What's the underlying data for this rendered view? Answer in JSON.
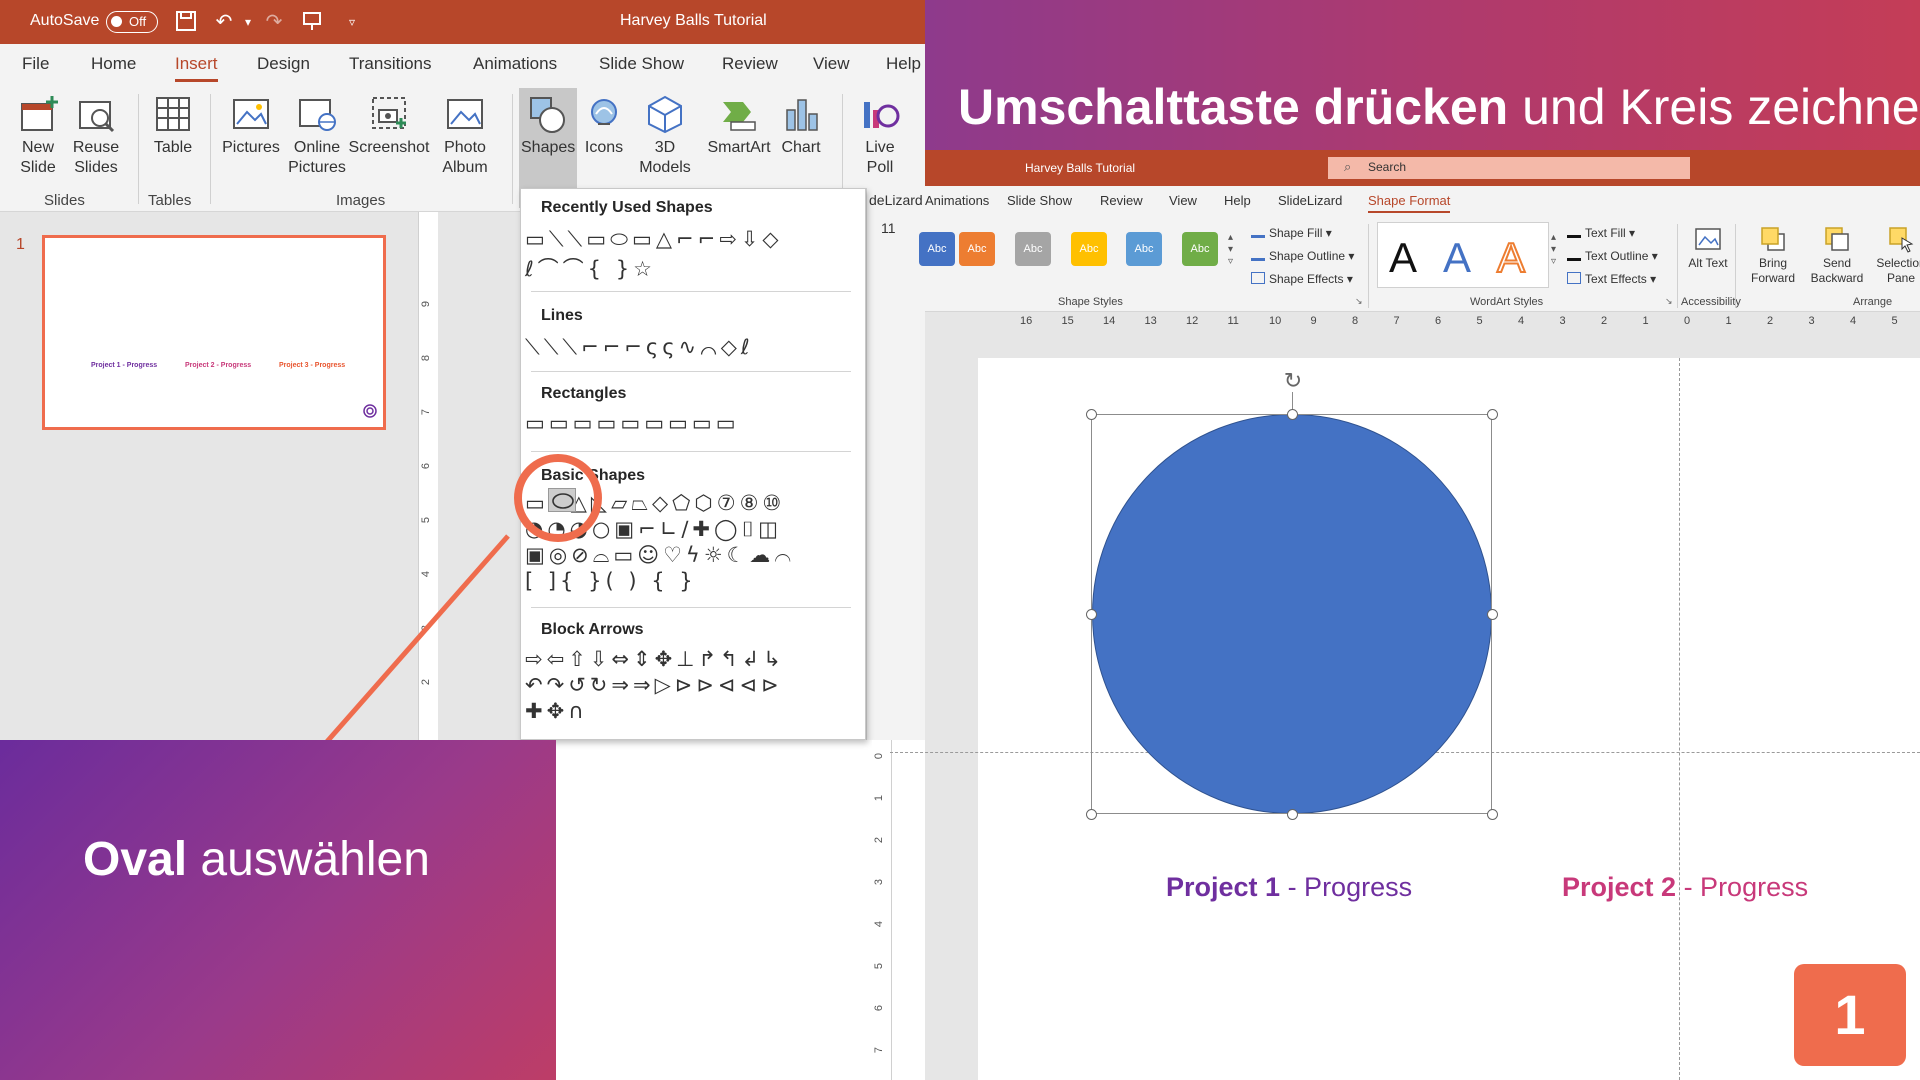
{
  "left_window": {
    "autosave_label": "AutoSave",
    "autosave_state": "Off",
    "title": "Harvey Balls Tutorial",
    "tabs": [
      "File",
      "Home",
      "Insert",
      "Design",
      "Transitions",
      "Animations",
      "Slide Show",
      "Review",
      "View",
      "Help"
    ],
    "active_tab": "Insert",
    "ribbon": {
      "new_slide": "New Slide",
      "reuse_slides": "Reuse Slides",
      "table": "Table",
      "pictures": "Pictures",
      "online_pictures": "Online Pictures",
      "screenshot": "Screenshot",
      "photo_album": "Photo Album",
      "shapes": "Shapes",
      "icons": "Icons",
      "models_3d": "3D Models",
      "smartart": "SmartArt",
      "chart": "Chart",
      "live_poll": "Live Poll",
      "groups": {
        "slides": "Slides",
        "tables": "Tables",
        "images": "Images"
      }
    },
    "slide_number": "1",
    "thumbnail_labels": [
      "Project 1 - Progress",
      "Project 2 - Progress",
      "Project 3 - Progress"
    ],
    "sliver_text": "deLizard",
    "font_size": "11"
  },
  "shapes_menu": {
    "recently_used": "Recently Used Shapes",
    "lines": "Lines",
    "rectangles": "Rectangles",
    "basic_shapes": "Basic Shapes",
    "block_arrows": "Block Arrows"
  },
  "captions": {
    "top_bold": "Umschalttaste drücken",
    "top_rest": " und Kreis zeichnen",
    "bottom_bold": "Oval",
    "bottom_rest": " auswählen"
  },
  "right_window": {
    "title": "Harvey Balls Tutorial",
    "search_placeholder": "Search",
    "tabs": [
      "Animations",
      "Slide Show",
      "Review",
      "View",
      "Help",
      "SlideLizard",
      "Shape Format"
    ],
    "active_tab": "Shape Format",
    "shape_style_label": "Abc",
    "shape_style_colors": [
      "#4472c4",
      "#ed7d31",
      "#a5a5a5",
      "#ffc000",
      "#5b9bd5",
      "#70ad47"
    ],
    "shape_fill": "Shape Fill",
    "shape_outline": "Shape Outline",
    "shape_effects": "Shape Effects",
    "wordart_letter": "A",
    "text_fill": "Text Fill",
    "text_outline": "Text Outline",
    "text_effects": "Text Effects",
    "alt_text": "Alt Text",
    "bring_forward": "Bring Forward",
    "send_backward": "Send Backward",
    "selection_pane": "Selection Pane",
    "groups": {
      "shape_styles": "Shape Styles",
      "wordart_styles": "WordArt Styles",
      "accessibility": "Accessibility",
      "arrange": "Arrange"
    },
    "ruler_numbers": [
      "16",
      "15",
      "14",
      "13",
      "12",
      "11",
      "10",
      "9",
      "8",
      "7",
      "6",
      "5",
      "4",
      "3",
      "2",
      "1",
      "0",
      "1",
      "2",
      "3",
      "4",
      "5"
    ],
    "slide_labels": {
      "p1_bold": "Project 1",
      "p1_rest": " - Progress",
      "p2_bold": "Project 2",
      "p2_rest": " - Progress"
    },
    "circle_color": "#4472c4"
  },
  "step_badge": "1",
  "colors": {
    "ppt_red": "#b7472a",
    "accent_orange": "#ef6c4d",
    "project1_purple": "#6f2f9f",
    "project2_pink": "#c8397a",
    "project3_orange": "#e8552f"
  }
}
